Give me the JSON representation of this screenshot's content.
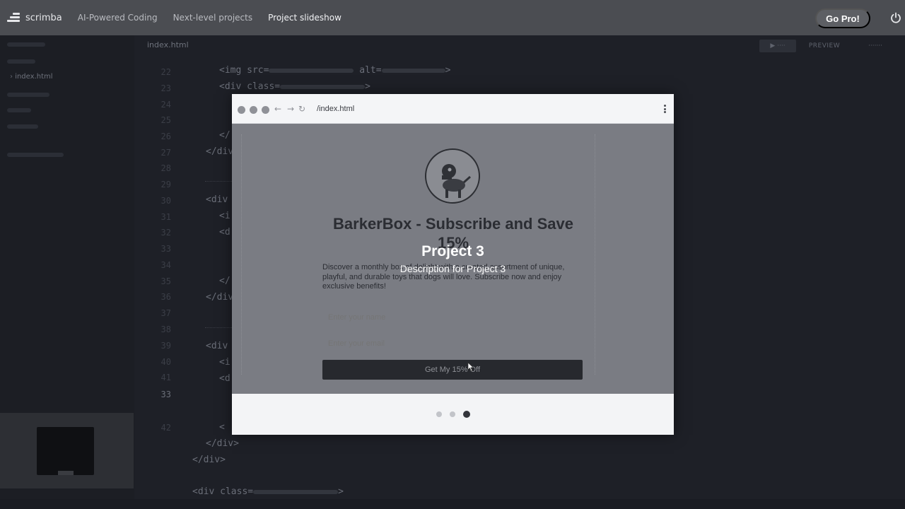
{
  "topnav": {
    "logo": "scrimba",
    "breadcrumbs": [
      "AI-Powered Coding",
      "Next-level projects",
      "Project slideshow"
    ],
    "cta": "Go Pro!"
  },
  "editor": {
    "tab": "index.html",
    "sidebar_file": "index.html",
    "line_numbers": [
      "22",
      "23",
      "24",
      "25",
      "26",
      "27",
      "28",
      "29",
      "30",
      "31",
      "32",
      "33",
      "34",
      "35",
      "36",
      "37",
      "38",
      "39",
      "40",
      "41",
      "42"
    ],
    "highlight_line": "33",
    "code": [
      "<img src=",
      "<div class=",
      "</",
      "</div>",
      "<div",
      "<i",
      "<d",
      "</",
      "</div>",
      "<div",
      "<i",
      "<d",
      "<",
      "</div>",
      "</div>",
      "<div class="
    ],
    "buttons": {
      "preview": "PREVIEW"
    }
  },
  "preview": {
    "url": "/index.html",
    "page": {
      "headline": "BarkerBox - Subscribe and Save 15%",
      "description": "Discover a monthly box of delight with a curated assortment of unique, playful, and durable toys that dogs will love. Subscribe now and enjoy exclusive benefits!",
      "name_placeholder": "Enter your name",
      "email_placeholder": "Enter your email",
      "button": "Get My 15% Off"
    },
    "slide": {
      "title": "Project 3",
      "description": "Description for Project 3"
    },
    "pager": {
      "total": 3,
      "active_index": 3
    }
  },
  "colors": {
    "topbar": "#4b4d52",
    "editor_bg": "#1e2027",
    "modal_bg": "#f3f4f6",
    "overlay_page": "#7a7c83",
    "cta_bg": "#27292e"
  }
}
